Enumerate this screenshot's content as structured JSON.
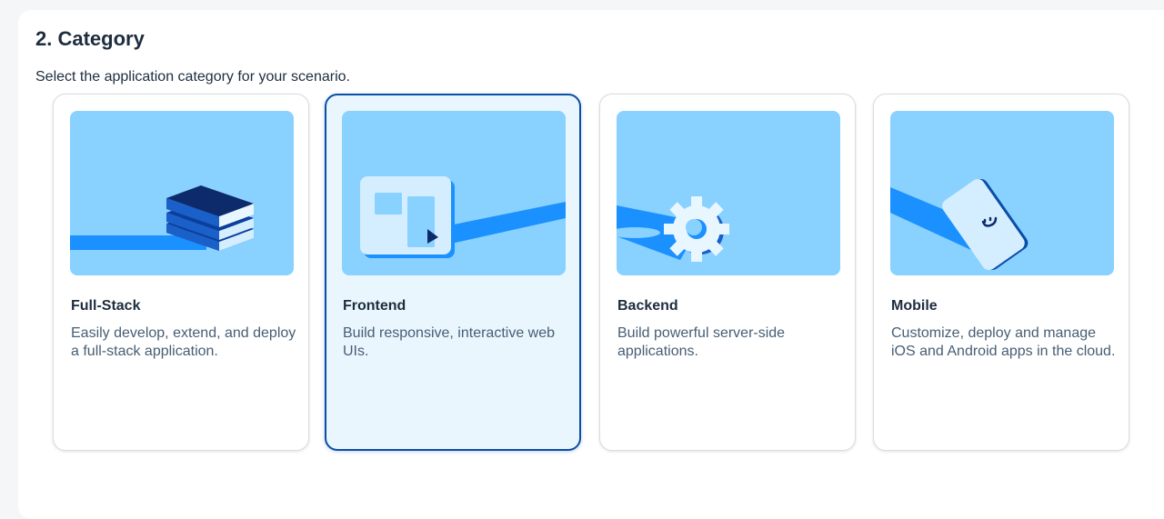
{
  "section": {
    "title": "2. Category",
    "subtitle": "Select the application category for your scenario."
  },
  "cards": [
    {
      "title": "Full-Stack",
      "description": "Easily develop, extend, and deploy a full-stack application.",
      "illustration": "layers-stack-icon",
      "selected": false
    },
    {
      "title": "Frontend",
      "description": "Build responsive, interactive web UIs.",
      "illustration": "browser-window-icon",
      "selected": true
    },
    {
      "title": "Backend",
      "description": "Build powerful server-side applications.",
      "illustration": "gear-icon",
      "selected": false
    },
    {
      "title": "Mobile",
      "description": "Customize, deploy and manage iOS and Android apps in the cloud.",
      "illustration": "mobile-phone-icon",
      "selected": false
    }
  ],
  "colors": {
    "accent": "#0a4ea8",
    "illustration_bg": "#89d1ff",
    "illustration_blue": "#1b90ff",
    "illustration_navy": "#0d2b6b",
    "selected_bg": "#eaf6fe"
  }
}
